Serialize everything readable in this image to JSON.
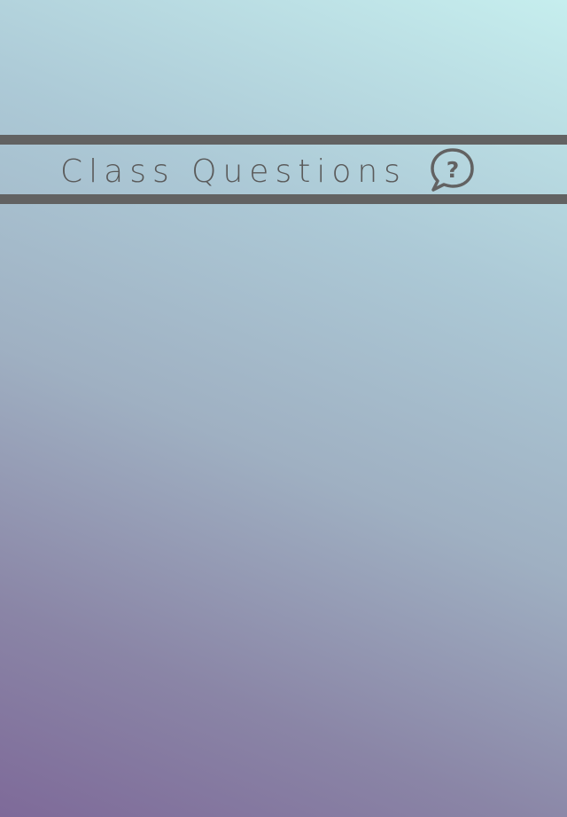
{
  "header": {
    "title": "Class Questions",
    "icon": "question-bubble-icon",
    "icon_glyph": "?"
  },
  "colors": {
    "stripe": "#626262",
    "text": "#5a5a5a",
    "gradient_top_right": "#c6eeee",
    "gradient_bottom_left": "#7e6a99"
  }
}
